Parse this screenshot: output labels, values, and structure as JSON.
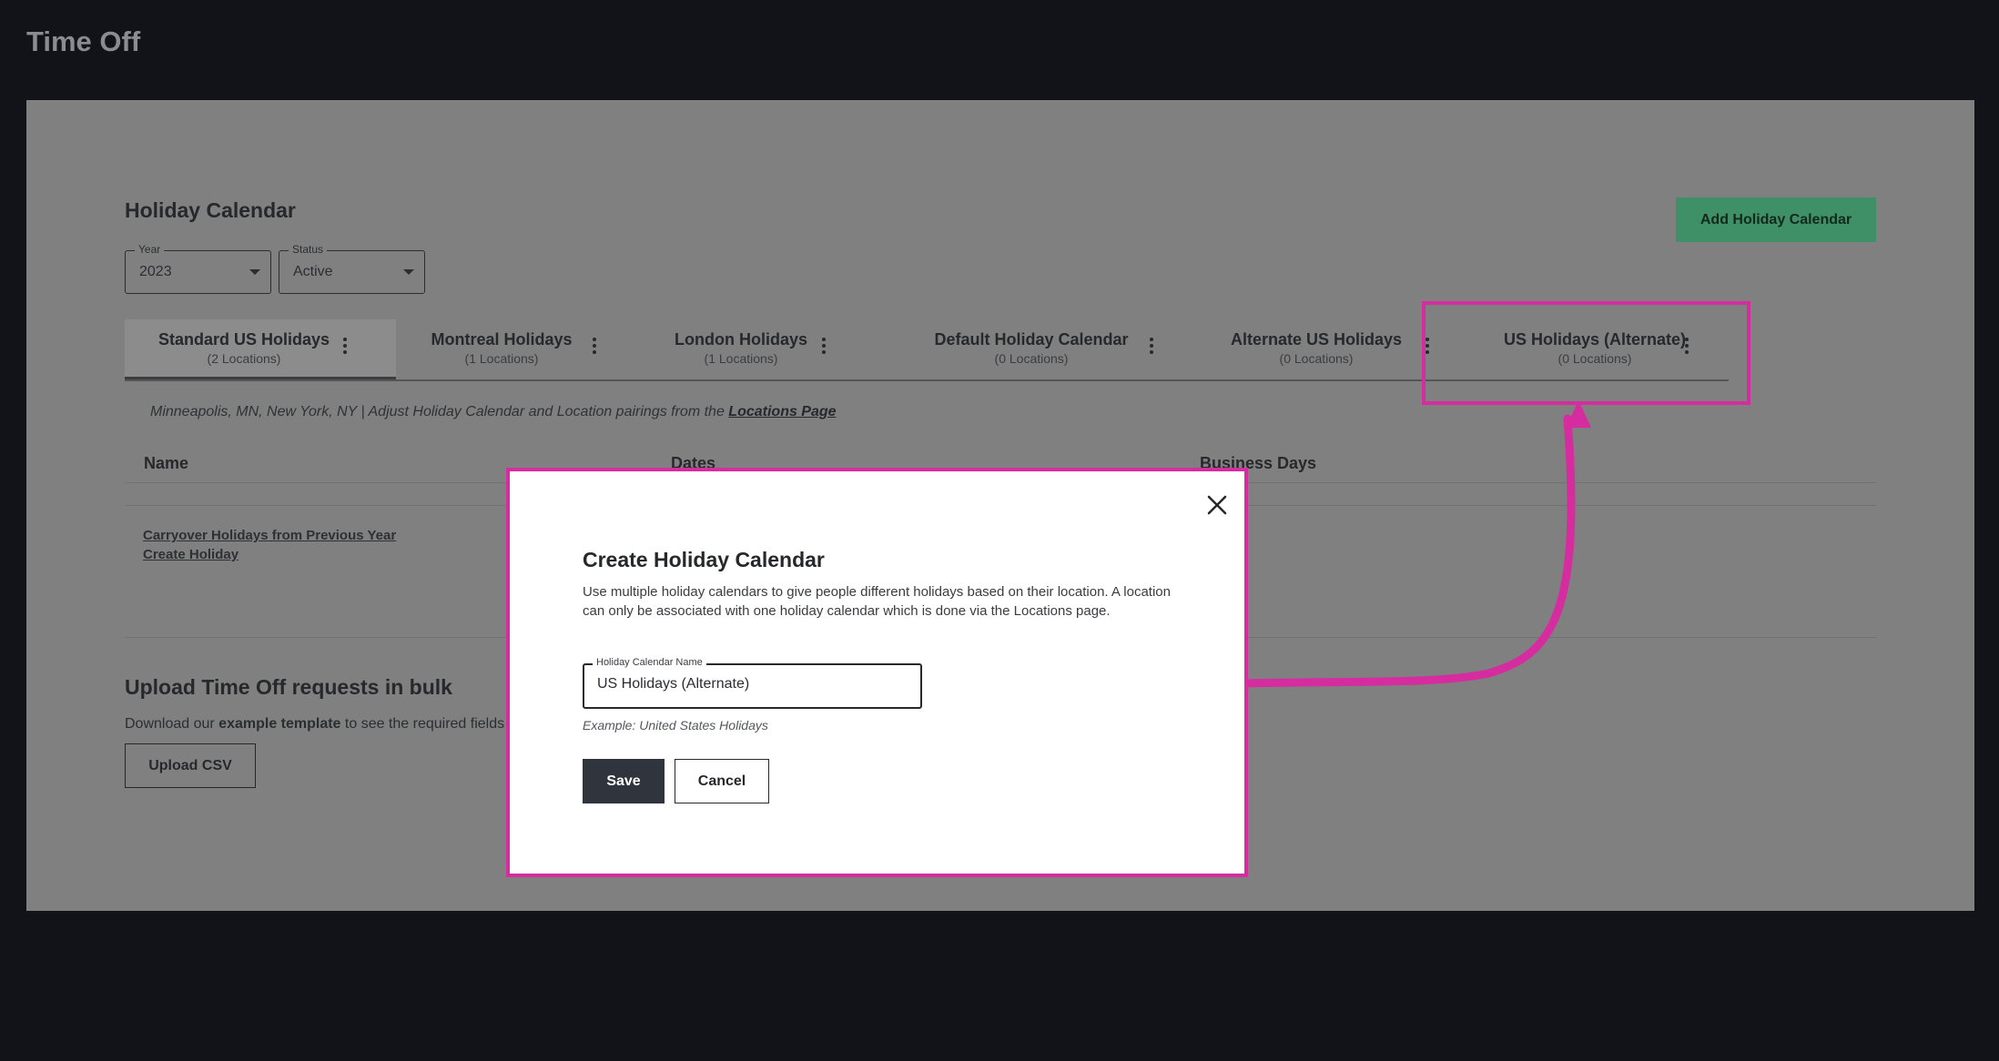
{
  "page": {
    "title": "Time Off"
  },
  "holiday_calendar": {
    "title": "Holiday Calendar",
    "add_button": "Add Holiday Calendar",
    "filters": {
      "year": {
        "label": "Year",
        "value": "2023"
      },
      "status": {
        "label": "Status",
        "value": "Active"
      }
    },
    "tabs": [
      {
        "name": "Standard US Holidays",
        "sub": "(2 Locations)",
        "active": true
      },
      {
        "name": "Montreal Holidays",
        "sub": "(1 Locations)",
        "active": false
      },
      {
        "name": "London Holidays",
        "sub": "(1 Locations)",
        "active": false
      },
      {
        "name": "Default Holiday Calendar",
        "sub": "(0 Locations)",
        "active": false
      },
      {
        "name": "Alternate US Holidays",
        "sub": "(0 Locations)",
        "active": false
      },
      {
        "name": "US Holidays (Alternate)",
        "sub": "(0 Locations)",
        "active": false
      }
    ],
    "info_text": "Minneapolis, MN, New York, NY | Adjust Holiday Calendar and Location pairings from the ",
    "info_link": "Locations Page",
    "columns": {
      "name": "Name",
      "dates": "Dates",
      "business_days": "Business Days"
    },
    "links": {
      "carryover": "Carryover Holidays from Previous Year",
      "create": "Create Holiday"
    }
  },
  "upload": {
    "title": "Upload Time Off requests in bulk",
    "text_prefix": "Download our ",
    "text_link": "example template",
    "text_suffix": " to see the required fields",
    "button": "Upload CSV"
  },
  "modal": {
    "title": "Create Holiday Calendar",
    "description": "Use multiple holiday calendars to give people different holidays based on their location. A location can only be associated with one holiday calendar which is done via the Locations page.",
    "field_label": "Holiday Calendar Name",
    "field_value": "US Holidays (Alternate)",
    "hint": "Example: United States Holidays",
    "save": "Save",
    "cancel": "Cancel"
  },
  "colors": {
    "annotation": "#d52d9f",
    "primary_button": "#3f8f67",
    "save_button": "#30343d"
  }
}
